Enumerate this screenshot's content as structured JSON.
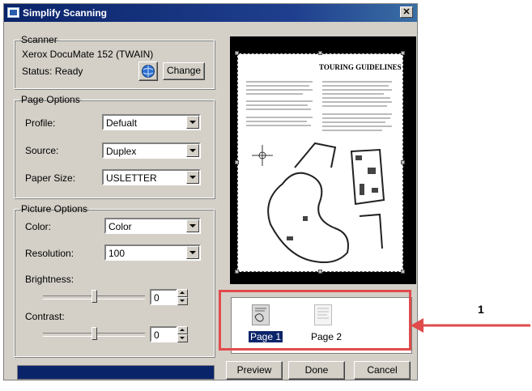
{
  "window": {
    "title": "Simplify Scanning",
    "close_glyph": "✕"
  },
  "scanner": {
    "legend": "Scanner",
    "name": "Xerox DocuMate 152 (TWAIN)",
    "status": "Status:  Ready",
    "change_label": "Change"
  },
  "page_options": {
    "legend": "Page Options",
    "profile_label": "Profile:",
    "profile_value": "Defualt",
    "source_label": "Source:",
    "source_value": "Duplex",
    "paper_size_label": "Paper Size:",
    "paper_size_value": "USLETTER"
  },
  "picture_options": {
    "legend": "Picture Options",
    "color_label": "Color:",
    "color_value": "Color",
    "resolution_label": "Resolution:",
    "resolution_value": "100",
    "brightness_label": "Brightness:",
    "brightness_value": "0",
    "contrast_label": "Contrast:",
    "contrast_value": "0"
  },
  "preview": {
    "doc_title": "TOURING GUIDELINES"
  },
  "pages": [
    {
      "label": "Page 1",
      "selected": true
    },
    {
      "label": "Page 2",
      "selected": false
    }
  ],
  "buttons": {
    "preview": "Preview",
    "done": "Done",
    "cancel": "Cancel"
  },
  "annotation": {
    "number": "1",
    "color": "#e14b4b"
  }
}
